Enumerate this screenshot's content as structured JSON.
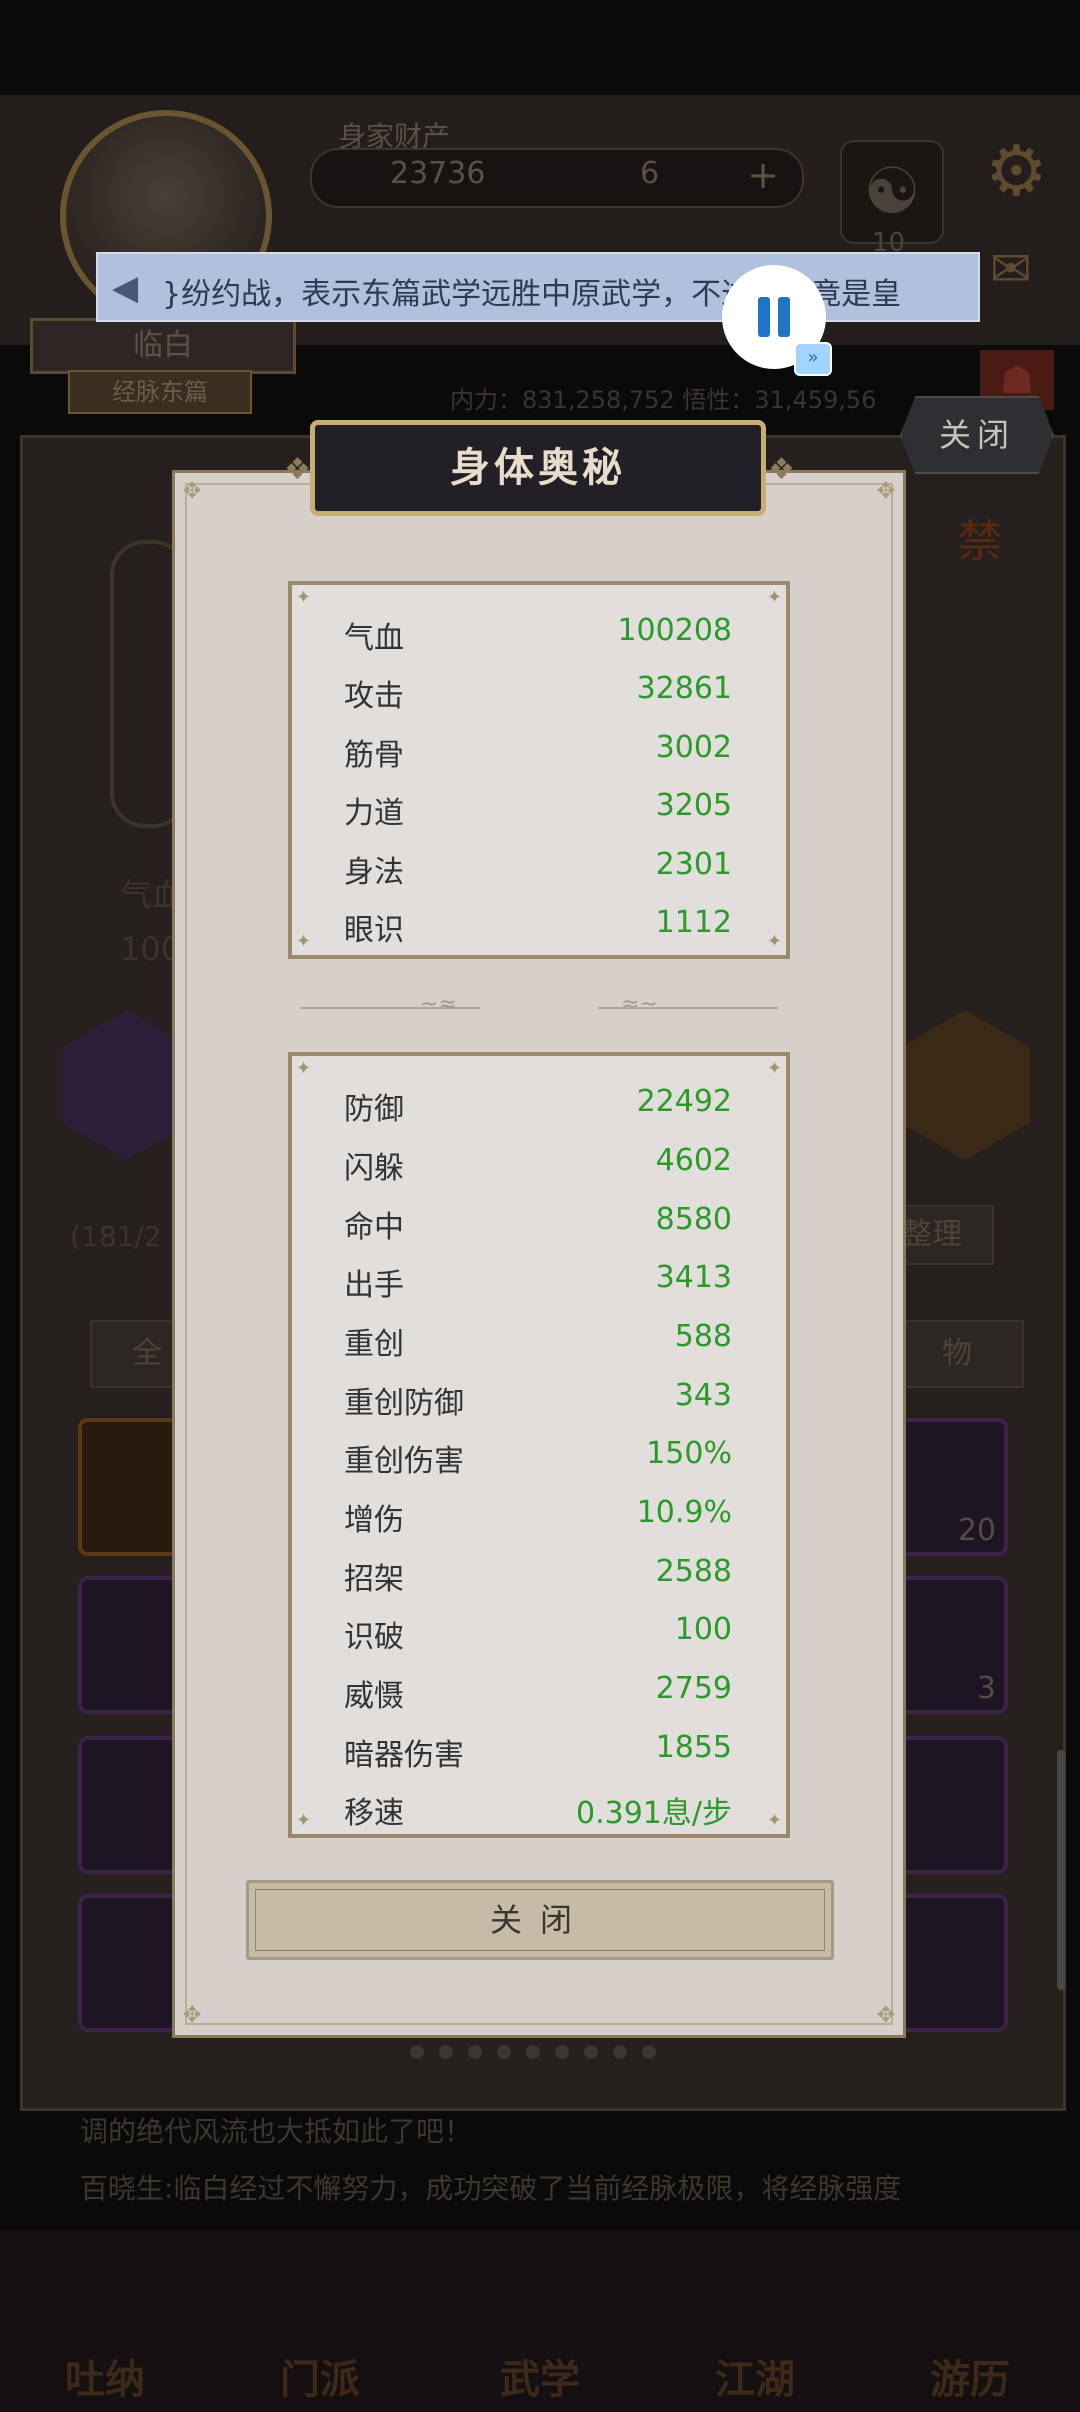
{
  "background": {
    "wealth_label": "身家财产",
    "coins": "23736",
    "gems": "6",
    "plus": "+",
    "yin_yang_count": "10",
    "player_name": "临白",
    "player_title": "经脉东篇",
    "stats_strip": "内力：831,258,752    悟性：31,459,56",
    "hp_label": "气血",
    "hp_value": "100",
    "bag_count": "(181/2",
    "sort_label": "整理",
    "tab_all": "全",
    "tab_items": "物",
    "slot_count_1": "20",
    "slot_count_2": "3",
    "log_line_1": "调的绝代风流也大抵如此了吧！",
    "log_line_2": "百晓生:临白经过不懈努力，成功突破了当前经脉极限，将经脉强度",
    "nav": [
      "吐纳",
      "门派",
      "武学",
      "江湖",
      "游历"
    ],
    "forbid_badge": "禁"
  },
  "outer_close": "关闭",
  "announcement": {
    "icon": "megaphone-icon",
    "text": "}纷约战，表示东篇武学远胜中原武学，不过他毕竟是皇"
  },
  "modal": {
    "title": "身体奥秘",
    "basic_stats": [
      {
        "label": "气血",
        "value": "100208"
      },
      {
        "label": "攻击",
        "value": "32861"
      },
      {
        "label": "筋骨",
        "value": "3002"
      },
      {
        "label": "力道",
        "value": "3205"
      },
      {
        "label": "身法",
        "value": "2301"
      },
      {
        "label": "眼识",
        "value": "1112"
      }
    ],
    "combat_stats": [
      {
        "label": "防御",
        "value": "22492"
      },
      {
        "label": "闪躲",
        "value": "4602"
      },
      {
        "label": "命中",
        "value": "8580"
      },
      {
        "label": "出手",
        "value": "3413"
      },
      {
        "label": "重创",
        "value": "588"
      },
      {
        "label": "重创防御",
        "value": "343"
      },
      {
        "label": "重创伤害",
        "value": "150%"
      },
      {
        "label": "增伤",
        "value": "10.9%"
      },
      {
        "label": "招架",
        "value": "2588"
      },
      {
        "label": "识破",
        "value": "100"
      },
      {
        "label": "威慑",
        "value": "2759"
      },
      {
        "label": "暗器伤害",
        "value": "1855"
      },
      {
        "label": "移速",
        "value": "0.391息/步"
      }
    ],
    "close_button": "关闭"
  },
  "colors": {
    "stat_value": "#2a9a2a",
    "title_border": "#c6ae72",
    "marquee_bg": "#b0c1dd",
    "pause_blue": "#1f74c9"
  }
}
